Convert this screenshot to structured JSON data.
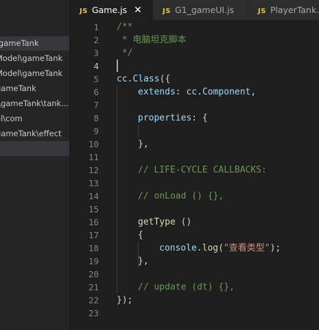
{
  "sidebar": {
    "items": [
      {
        "label": "\\gameTank",
        "selected": true
      },
      {
        "label": "Model\\gameTank",
        "selected": false
      },
      {
        "label": "Model\\gameTank",
        "selected": false
      },
      {
        "label": "gameTank",
        "selected": false
      },
      {
        "label": "l\\gameTank\\tank...",
        "selected": false
      },
      {
        "label": "el\\com",
        "selected": false
      },
      {
        "label": "gameTank\\effect",
        "selected": false
      }
    ]
  },
  "tabs": [
    {
      "icon": "JS",
      "label": "Game.js",
      "active": true,
      "close": "✕"
    },
    {
      "icon": "JS",
      "label": "G1_gameUI.js",
      "active": false
    },
    {
      "icon": "JS",
      "label": "PlayerTank.js",
      "active": false
    }
  ],
  "editor": {
    "line_numbers": [
      "1",
      "2",
      "3",
      "4",
      "5",
      "6",
      "7",
      "8",
      "9",
      "10",
      "11",
      "12",
      "13",
      "14",
      "15",
      "16",
      "17",
      "18",
      "19",
      "20",
      "21",
      "22",
      "23"
    ],
    "lines": {
      "l1": "/**",
      "l2": " * 电脑坦克脚本",
      "l3": " */",
      "l5a": "cc",
      "l5b": ".",
      "l5c": "Class",
      "l5d": "({",
      "l6a": "extends",
      "l6b": ": ",
      "l6c": "cc",
      "l6d": ".",
      "l6e": "Component",
      "l6f": ",",
      "l8a": "properties",
      "l8b": ": {",
      "l10": "},",
      "l12": "// LIFE-CYCLE CALLBACKS:",
      "l14": "// onLoad () {},",
      "l16a": "getType",
      "l16b": " ()",
      "l17": "{",
      "l18a": "console",
      "l18b": ".",
      "l18c": "log",
      "l18d": "(",
      "l18e": "\"查看类型\"",
      "l18f": ");",
      "l19": "},",
      "l21": "// update (dt) {},",
      "l22": "});"
    }
  }
}
